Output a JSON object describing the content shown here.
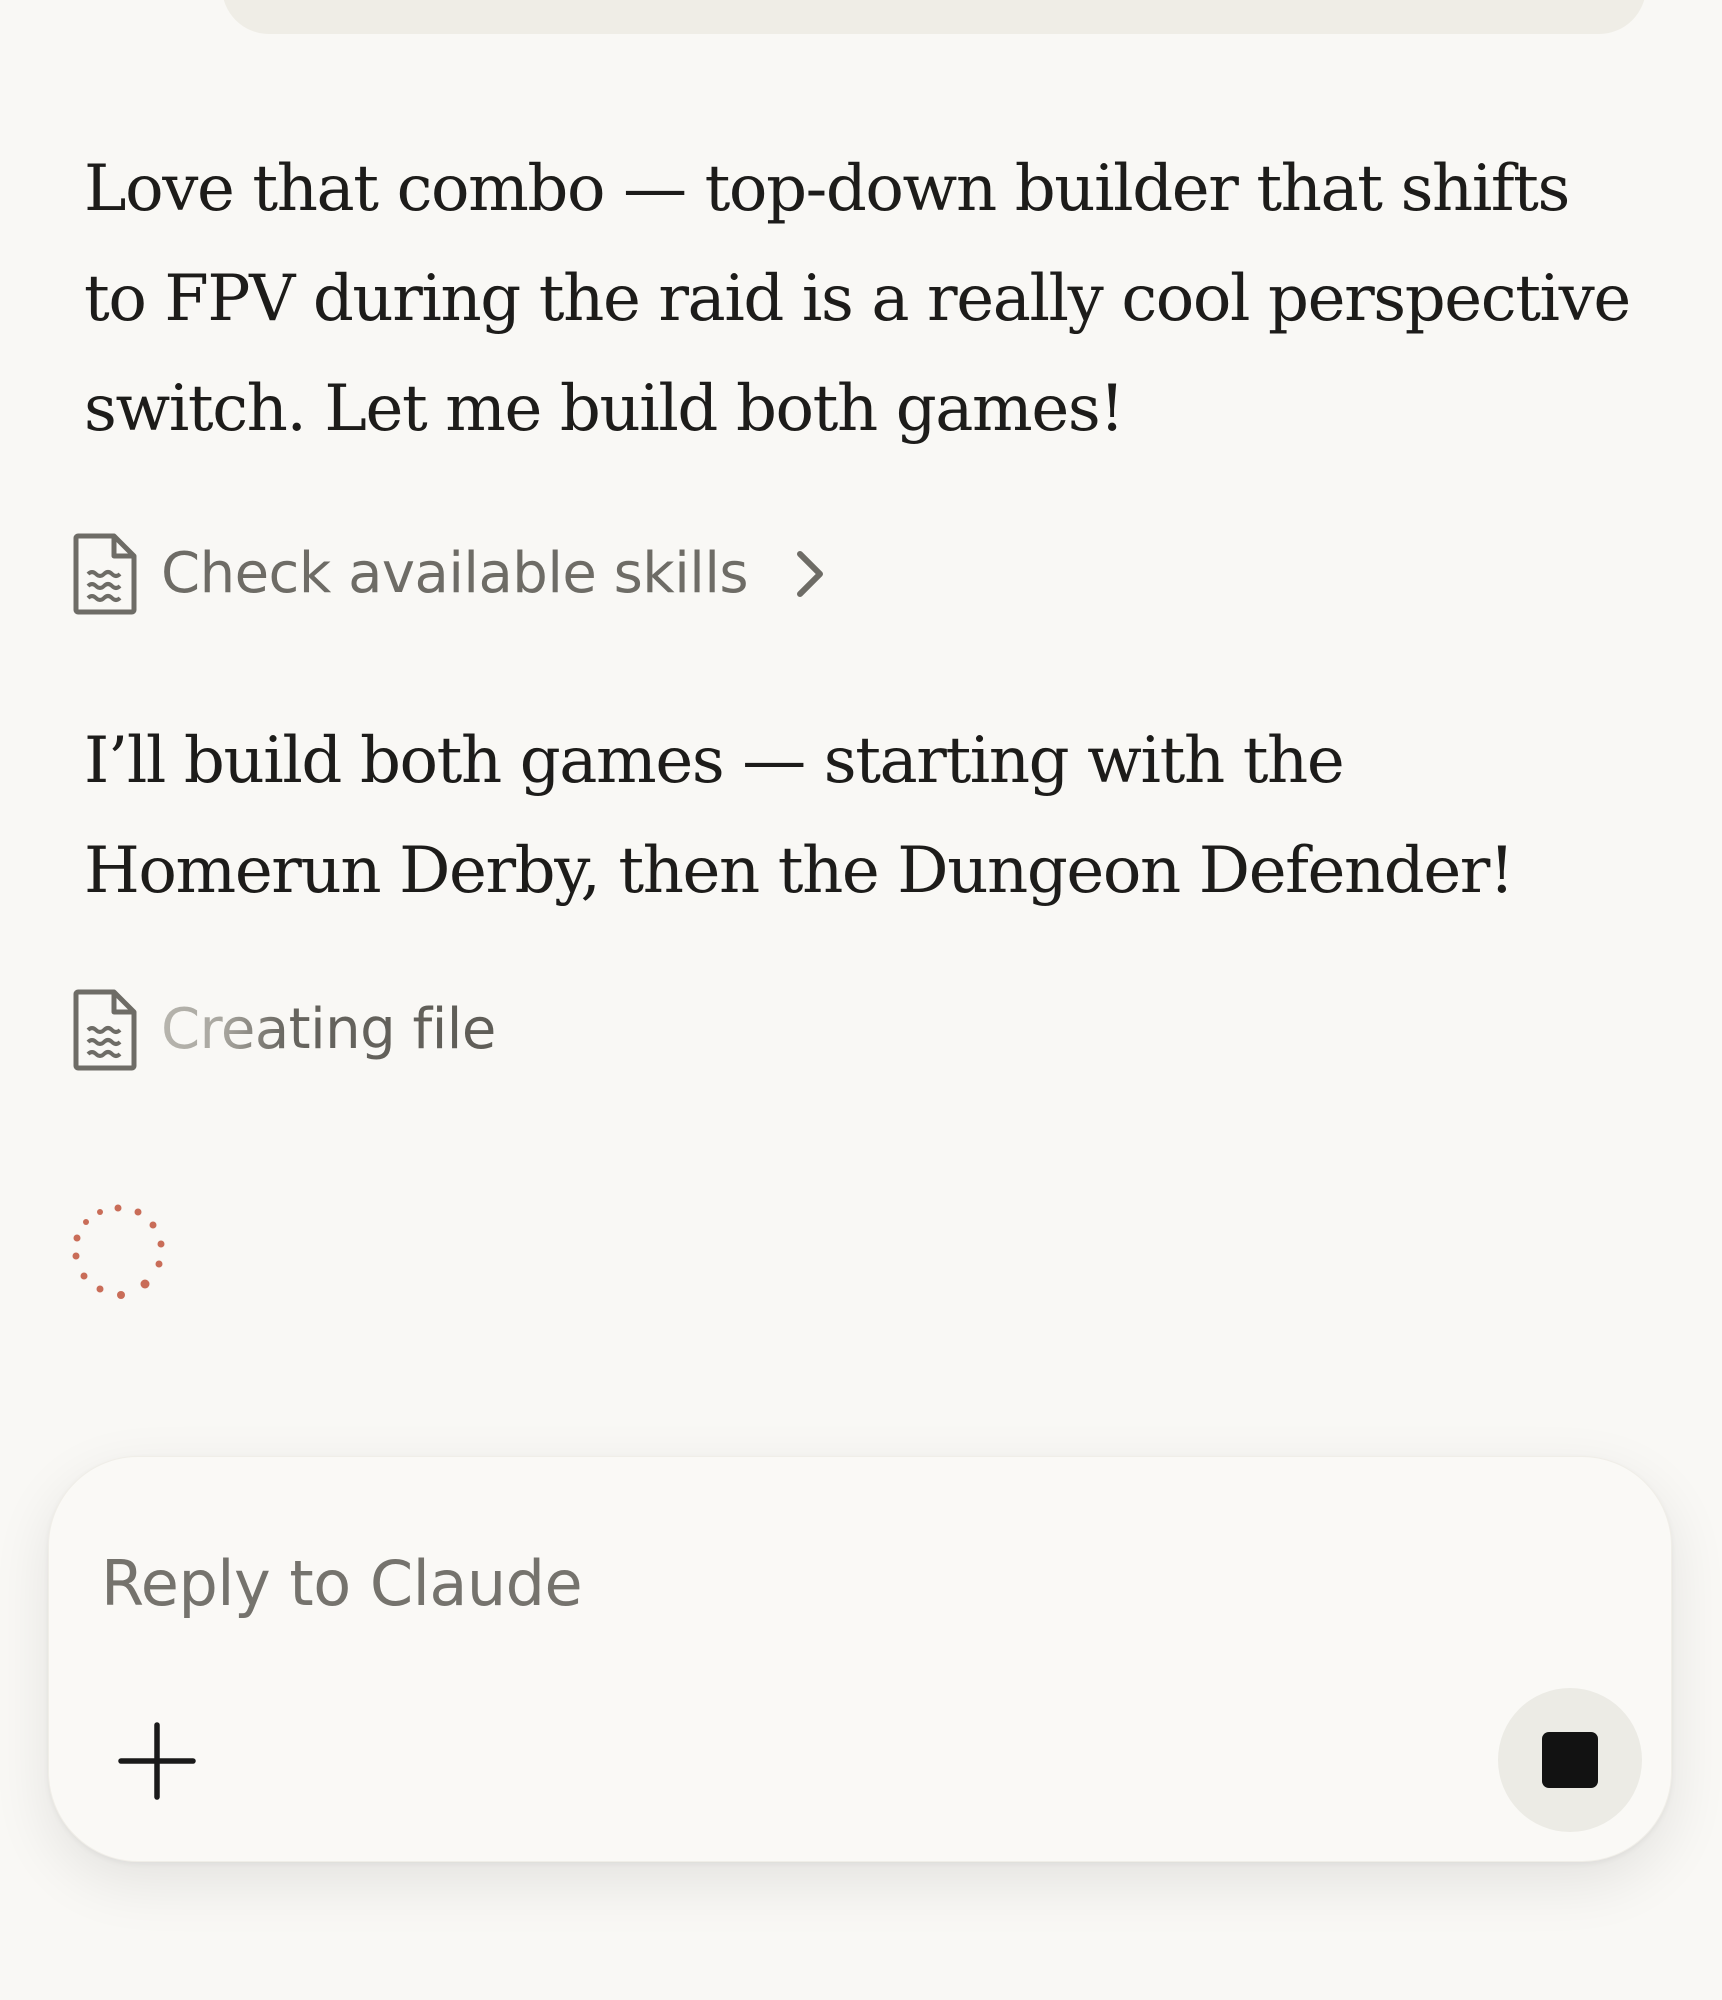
{
  "conversation": {
    "assistant_message_1": "Love that combo — top-down builder that shifts to FPV during the raid is a really cool perspective switch. Let me build both games!",
    "tool_call_1": {
      "label": "Check available skills",
      "icon": "document-icon",
      "expand_icon": "chevron-right-icon"
    },
    "assistant_message_2": "I’ll build both games — starting with the Homerun Derby, then the Dungeon Defender!",
    "tool_call_2": {
      "label": "Creating file",
      "icon": "document-icon",
      "status": "in-progress"
    },
    "loading_indicator": "spinner-icon"
  },
  "composer": {
    "placeholder": "Reply to Claude",
    "value": "",
    "add_icon": "plus-icon",
    "stop_icon": "stop-icon"
  },
  "colors": {
    "background": "#f9f8f5",
    "text": "#1d1c1a",
    "muted_text": "#6e6c66",
    "spinner": "#c96d58",
    "stop_button_bg": "#ecebe5"
  }
}
